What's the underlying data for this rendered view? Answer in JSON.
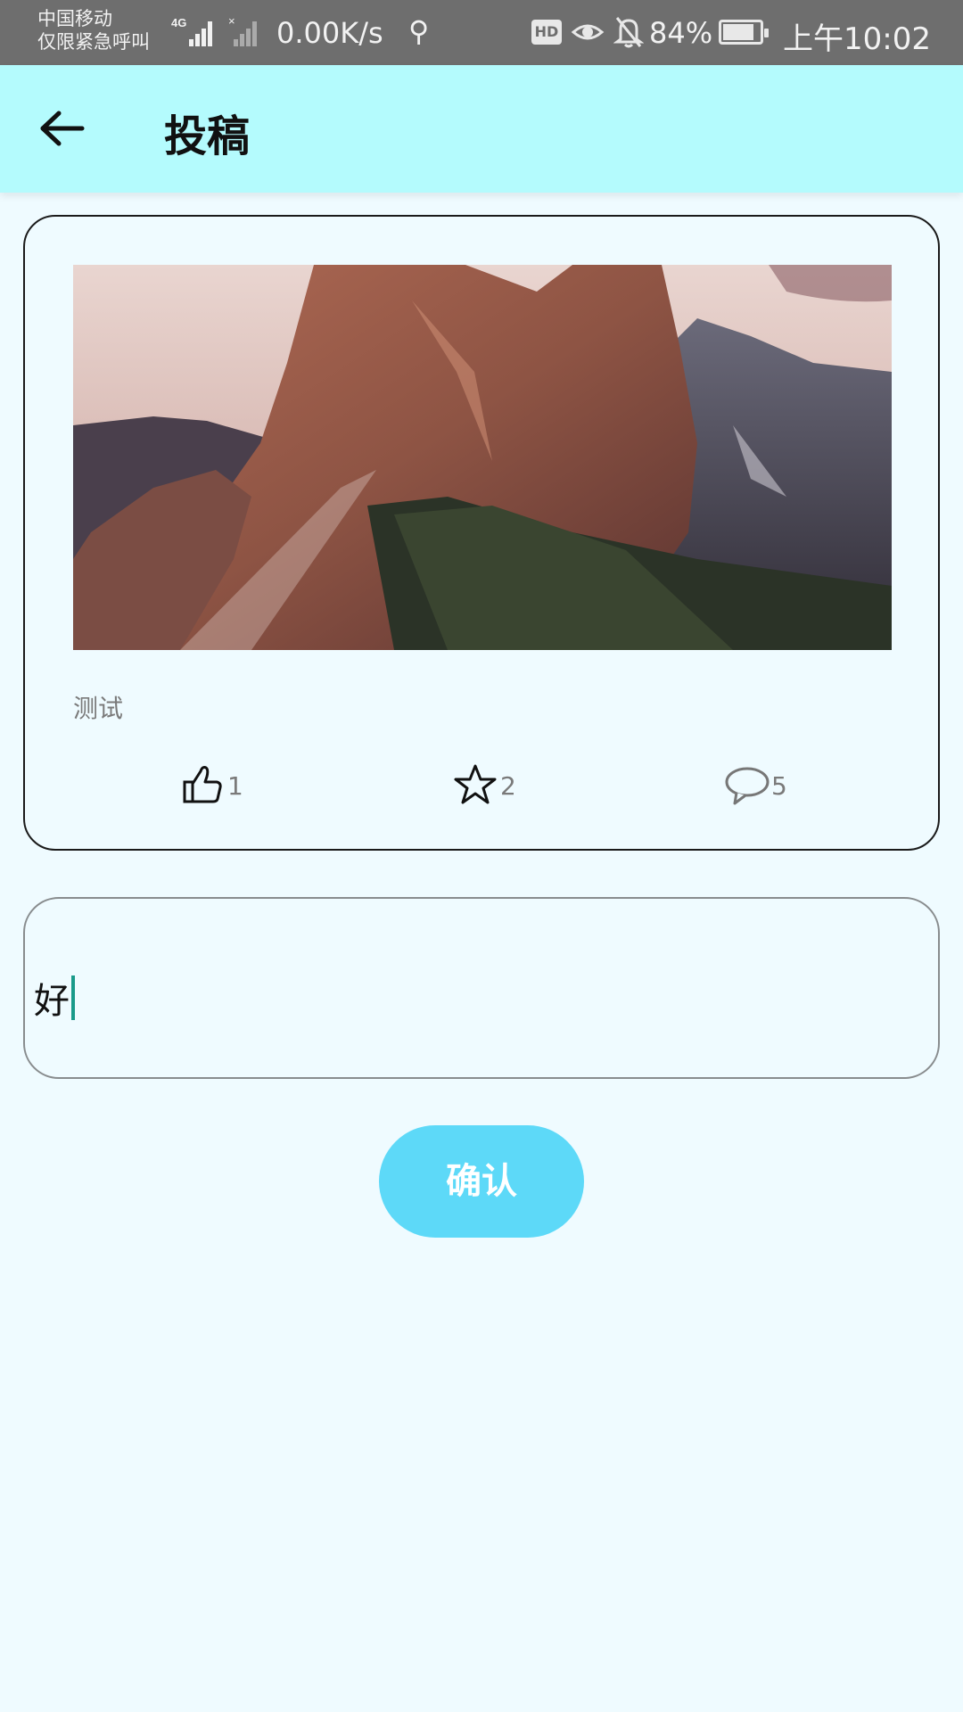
{
  "status_bar": {
    "carrier_line1": "中国移动",
    "carrier_line2": "仅限紧急呼叫",
    "network_type": "4G",
    "net_speed": "0.00K/s",
    "hd_badge": "HD",
    "battery_percent": "84%",
    "battery_level": 0.84,
    "time": "上午10:02"
  },
  "app_bar": {
    "title": "投稿",
    "back_icon": "arrow-left-icon"
  },
  "post": {
    "caption": "测试",
    "likes": "1",
    "favorites": "2",
    "comments": "5",
    "icons": [
      "thumbs-up-icon",
      "star-icon",
      "comment-icon"
    ]
  },
  "comment_input": {
    "value": "好"
  },
  "confirm_button": {
    "label": "确认"
  },
  "colors": {
    "app_bar_bg": "#b4fbfd",
    "page_bg": "#effbff",
    "button_bg": "#5dd9f8",
    "caret": "#1a9a8a"
  }
}
